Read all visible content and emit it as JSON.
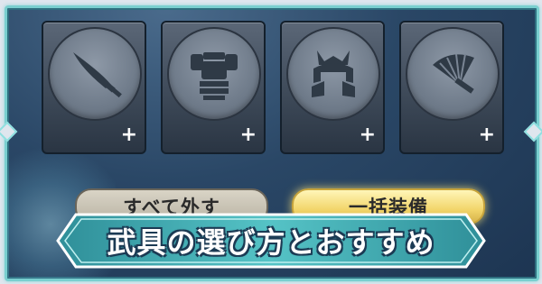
{
  "slots": [
    {
      "icon": "sword-icon",
      "add": "+"
    },
    {
      "icon": "armor-icon",
      "add": "+"
    },
    {
      "icon": "helmet-icon",
      "add": "+"
    },
    {
      "icon": "fan-icon",
      "add": "+"
    }
  ],
  "buttons": {
    "remove_all": "すべて外す",
    "equip_all": "一括装備"
  },
  "banner": {
    "title": "武具の選び方とおすすめ"
  },
  "colors": {
    "frame_border": "#79cfcf",
    "banner_fill": "#43b3b8",
    "equip_button": "#f2d56a",
    "remove_button": "#c8c2b2"
  }
}
